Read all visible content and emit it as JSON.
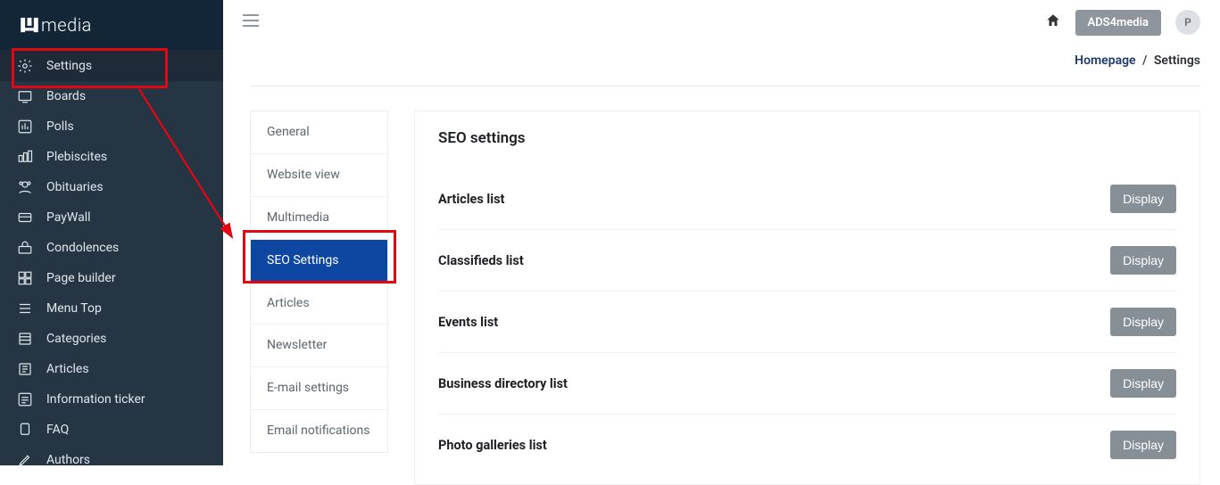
{
  "brand": {
    "text": "media"
  },
  "sidebar": {
    "items": [
      {
        "label": "Settings",
        "icon": "gear-icon"
      },
      {
        "label": "Boards",
        "icon": "board-icon"
      },
      {
        "label": "Polls",
        "icon": "polls-icon"
      },
      {
        "label": "Plebiscites",
        "icon": "plebiscites-icon"
      },
      {
        "label": "Obituaries",
        "icon": "obituaries-icon"
      },
      {
        "label": "PayWall",
        "icon": "paywall-icon"
      },
      {
        "label": "Condolences",
        "icon": "condolences-icon"
      },
      {
        "label": "Page builder",
        "icon": "pagebuilder-icon"
      },
      {
        "label": "Menu Top",
        "icon": "menu-icon"
      },
      {
        "label": "Categories",
        "icon": "categories-icon"
      },
      {
        "label": "Articles",
        "icon": "articles-icon"
      },
      {
        "label": "Information ticker",
        "icon": "ticker-icon"
      },
      {
        "label": "FAQ",
        "icon": "faq-icon"
      },
      {
        "label": "Authors",
        "icon": "authors-icon"
      }
    ]
  },
  "topbar": {
    "account_badge": "ADS4media",
    "avatar_initial": "P"
  },
  "breadcrumb": {
    "home": "Homepage",
    "current": "Settings"
  },
  "subnav": {
    "items": [
      "General",
      "Website view",
      "Multimedia",
      "SEO Settings",
      "Articles",
      "Newsletter",
      "E-mail settings",
      "Email notifications"
    ],
    "active_index": 3
  },
  "card": {
    "title": "SEO settings",
    "action_label": "Display",
    "rows": [
      "Articles list",
      "Classifieds list",
      "Events list",
      "Business directory list",
      "Photo galleries list"
    ]
  }
}
